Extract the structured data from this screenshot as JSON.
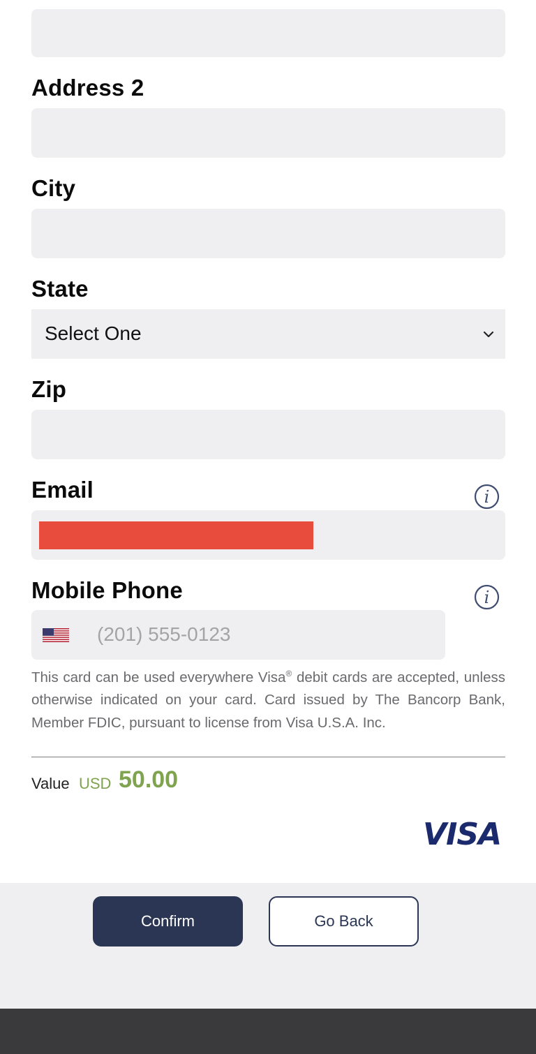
{
  "form": {
    "address2_label": "Address 2",
    "city_label": "City",
    "state_label": "State",
    "state_selected": "Select One",
    "zip_label": "Zip",
    "email_label": "Email",
    "phone_label": "Mobile Phone",
    "phone_placeholder": "(201) 555-0123"
  },
  "icons": {
    "info": "info-icon",
    "chevron": "chevron-down-icon",
    "flag": "us-flag-icon"
  },
  "disclaimer": {
    "part1": "This card can be used everywhere Visa",
    "reg": "®",
    "part2": " debit cards are accepted, unless otherwise indicated on your card. Card issued by The Bancorp Bank, Member FDIC, pursuant to license from Visa U.S.A. Inc."
  },
  "value": {
    "label": "Value",
    "currency": "USD",
    "amount": "50.00"
  },
  "brand": {
    "logo_text": "VISA"
  },
  "actions": {
    "confirm_label": "Confirm",
    "back_label": "Go Back"
  },
  "colors": {
    "primary": "#2b3654",
    "accent_green": "#7fa34e",
    "field_bg": "#efeff1",
    "redaction": "#e74c3c",
    "visa_blue": "#1a2a6c"
  }
}
